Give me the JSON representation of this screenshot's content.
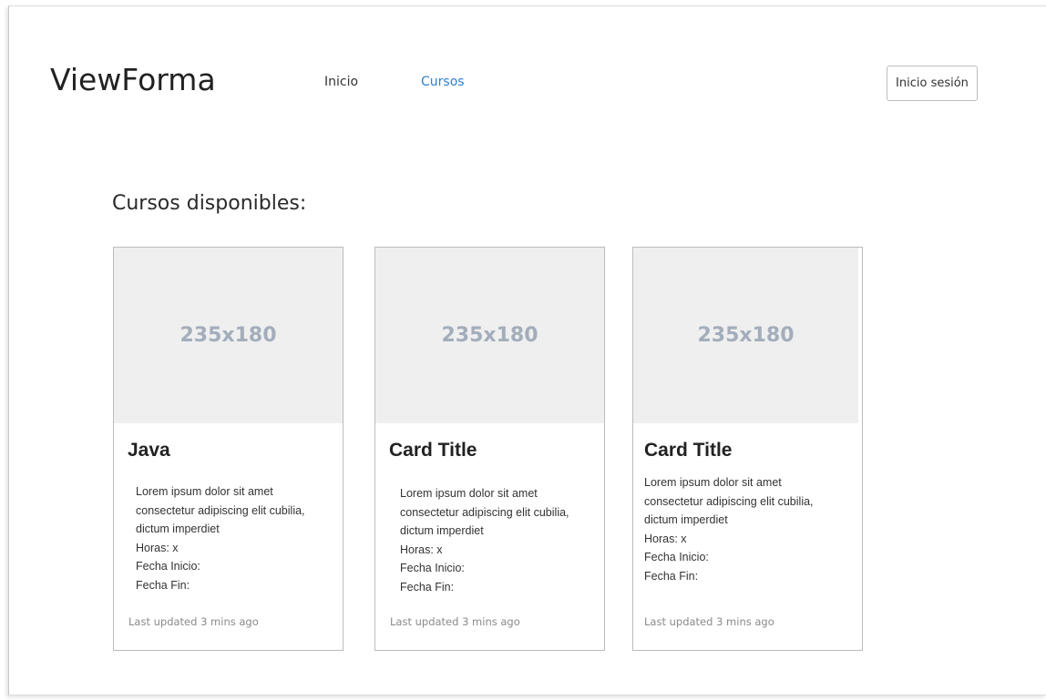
{
  "header": {
    "brand": "ViewForma",
    "nav": [
      {
        "label": "Inicio"
      },
      {
        "label": "Cursos"
      }
    ],
    "login_label": "Inicio sesión"
  },
  "colors": {
    "nav_active": "#2f7fcf",
    "placeholder_bg": "#efefef",
    "placeholder_text": "#a3adbb"
  },
  "main": {
    "section_title": "Cursos disponibles:",
    "cards": [
      {
        "image_label": "235x180",
        "title": "Java",
        "description_lines": [
          "Lorem ipsum dolor sit amet",
          "consectetur adipiscing elit cubilia,",
          "dictum imperdiet"
        ],
        "hours": "Horas: x",
        "start_date": "Fecha Inicio:",
        "end_date": "Fecha Fin:",
        "footer": "Last updated 3 mins ago"
      },
      {
        "image_label": "235x180",
        "title": "Card Title",
        "description_lines": [
          "Lorem ipsum dolor sit amet",
          "consectetur adipiscing elit cubilia,",
          "dictum imperdiet"
        ],
        "hours": "Horas: x",
        "start_date": "Fecha Inicio:",
        "end_date": "Fecha Fin:",
        "footer": "Last updated 3 mins ago"
      },
      {
        "image_label": "235x180",
        "title": "Card Title",
        "description_lines": [
          "Lorem ipsum dolor sit amet",
          "consectetur adipiscing elit cubilia,",
          "dictum imperdiet"
        ],
        "hours": "Horas: x",
        "start_date": "Fecha Inicio:",
        "end_date": "Fecha Fin:",
        "footer": "Last updated 3 mins ago"
      }
    ]
  }
}
